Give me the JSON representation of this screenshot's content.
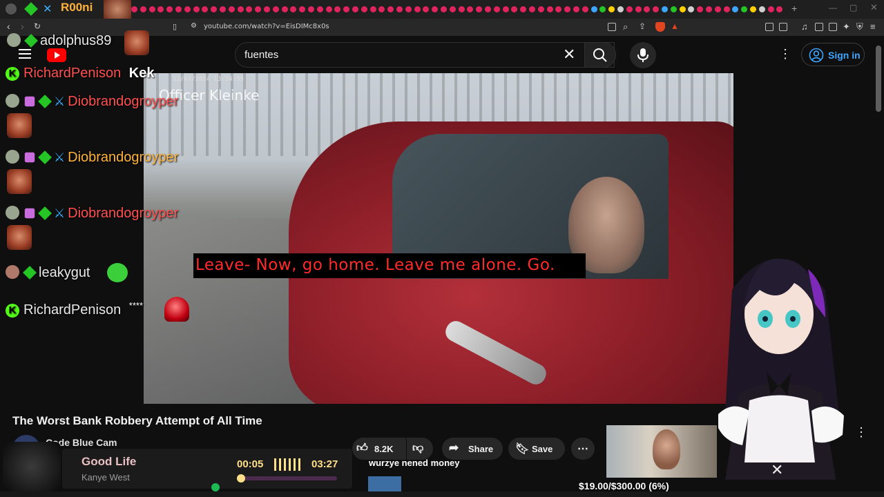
{
  "browser": {
    "tab_label": "R00ni",
    "url": "youtube.com/watch?v=EisDIMc8x0s"
  },
  "youtube": {
    "search_value": "fuentes",
    "sign_in_label": "Sign in",
    "video_title": "The Worst Bank Robbery Attempt of All Time",
    "channel_name": "Code Blue Cam",
    "like_count": "8.2K",
    "share_label": "Share",
    "save_label": "Save"
  },
  "video": {
    "overlay_timestamp": "12/07/2024 13:34:35",
    "officer_label": "Officer Kleinke",
    "caption": "Leave- Now, go home. Leave me alone. Go."
  },
  "chat": [
    {
      "user": "adolphus89",
      "message": ""
    },
    {
      "user": "RichardPenison",
      "message": "Kek"
    },
    {
      "user": "Diobrandogroyper",
      "message": ""
    },
    {
      "user": "Diobrandogroyper",
      "message": ""
    },
    {
      "user": "Diobrandogroyper",
      "message": ""
    },
    {
      "user": "leakygut",
      "message": ""
    },
    {
      "user": "RichardPenison",
      "message": "****"
    }
  ],
  "now_playing": {
    "title": "Good Life",
    "artist": "Kanye West",
    "elapsed": "00:05",
    "duration": "03:27",
    "progress": 0.03
  },
  "overlay": {
    "tts_text": "wurzye nened money",
    "goal_text": "$19.00/$300.00 (6%)"
  },
  "colors": {
    "caption_red": "#ff2a2a",
    "youtube_bg": "#0f0f0f",
    "signin_blue": "#3ea6ff",
    "progress_magenta": "#e02bd8"
  }
}
